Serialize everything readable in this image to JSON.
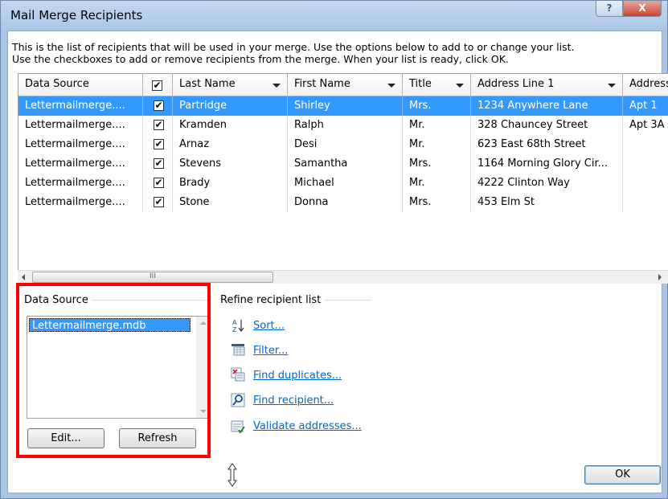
{
  "window": {
    "title": "Mail Merge Recipients",
    "help_label": "?",
    "close_label": "X"
  },
  "intro": {
    "line1": "This is the list of recipients that will be used in your merge.  Use the options below to add to or change your list.",
    "line2": "Use the checkboxes to add or remove recipients from the merge.  When your list is ready, click OK."
  },
  "table": {
    "headers": {
      "data_source": "Data Source",
      "check": "✔",
      "last_name": "Last Name",
      "first_name": "First Name",
      "title": "Title",
      "address1": "Address Line 1",
      "address2": "Address"
    },
    "rows": [
      {
        "source": "Lettermailmerge....",
        "checked": "✔",
        "last": "Partridge",
        "first": "Shirley",
        "title": "Mrs.",
        "addr1": "1234 Anywhere Lane",
        "addr2": "Apt 1"
      },
      {
        "source": "Lettermailmerge....",
        "checked": "✔",
        "last": "Kramden",
        "first": "Ralph",
        "title": "Mr.",
        "addr1": "328 Chauncey Street",
        "addr2": "Apt 3A"
      },
      {
        "source": "Lettermailmerge....",
        "checked": "✔",
        "last": "Arnaz",
        "first": "Desi",
        "title": "Mr.",
        "addr1": "623 East 68th Street",
        "addr2": ""
      },
      {
        "source": "Lettermailmerge....",
        "checked": "✔",
        "last": "Stevens",
        "first": "Samantha",
        "title": "Mrs.",
        "addr1": "1164 Morning Glory Cir...",
        "addr2": ""
      },
      {
        "source": "Lettermailmerge....",
        "checked": "✔",
        "last": "Brady",
        "first": "Michael",
        "title": "Mr.",
        "addr1": "4222 Clinton Way",
        "addr2": ""
      },
      {
        "source": "Lettermailmerge....",
        "checked": "✔",
        "last": "Stone",
        "first": "Donna",
        "title": "Mrs.",
        "addr1": "453 Elm St",
        "addr2": ""
      }
    ],
    "scroll_grip": "III"
  },
  "data_source_panel": {
    "label": "Data Source",
    "items": [
      "Lettermailmerge.mdb"
    ],
    "edit_label": "Edit...",
    "refresh_label": "Refresh"
  },
  "refine": {
    "label": "Refine recipient list",
    "links": {
      "sort": "Sort...",
      "filter": "Filter...",
      "duplicates": "Find duplicates...",
      "recipient": "Find recipient...",
      "validate": "Validate addresses..."
    }
  },
  "ok_label": "OK",
  "icons": {
    "sort": "sort-az-icon",
    "filter": "filter-icon",
    "duplicates": "find-duplicates-icon",
    "recipient": "find-recipient-icon",
    "validate": "validate-addresses-icon",
    "resize": "resize-grip-icon"
  },
  "colors": {
    "selection": "#3399ff",
    "highlight_box": "#ff0000",
    "link": "#0066cc"
  }
}
